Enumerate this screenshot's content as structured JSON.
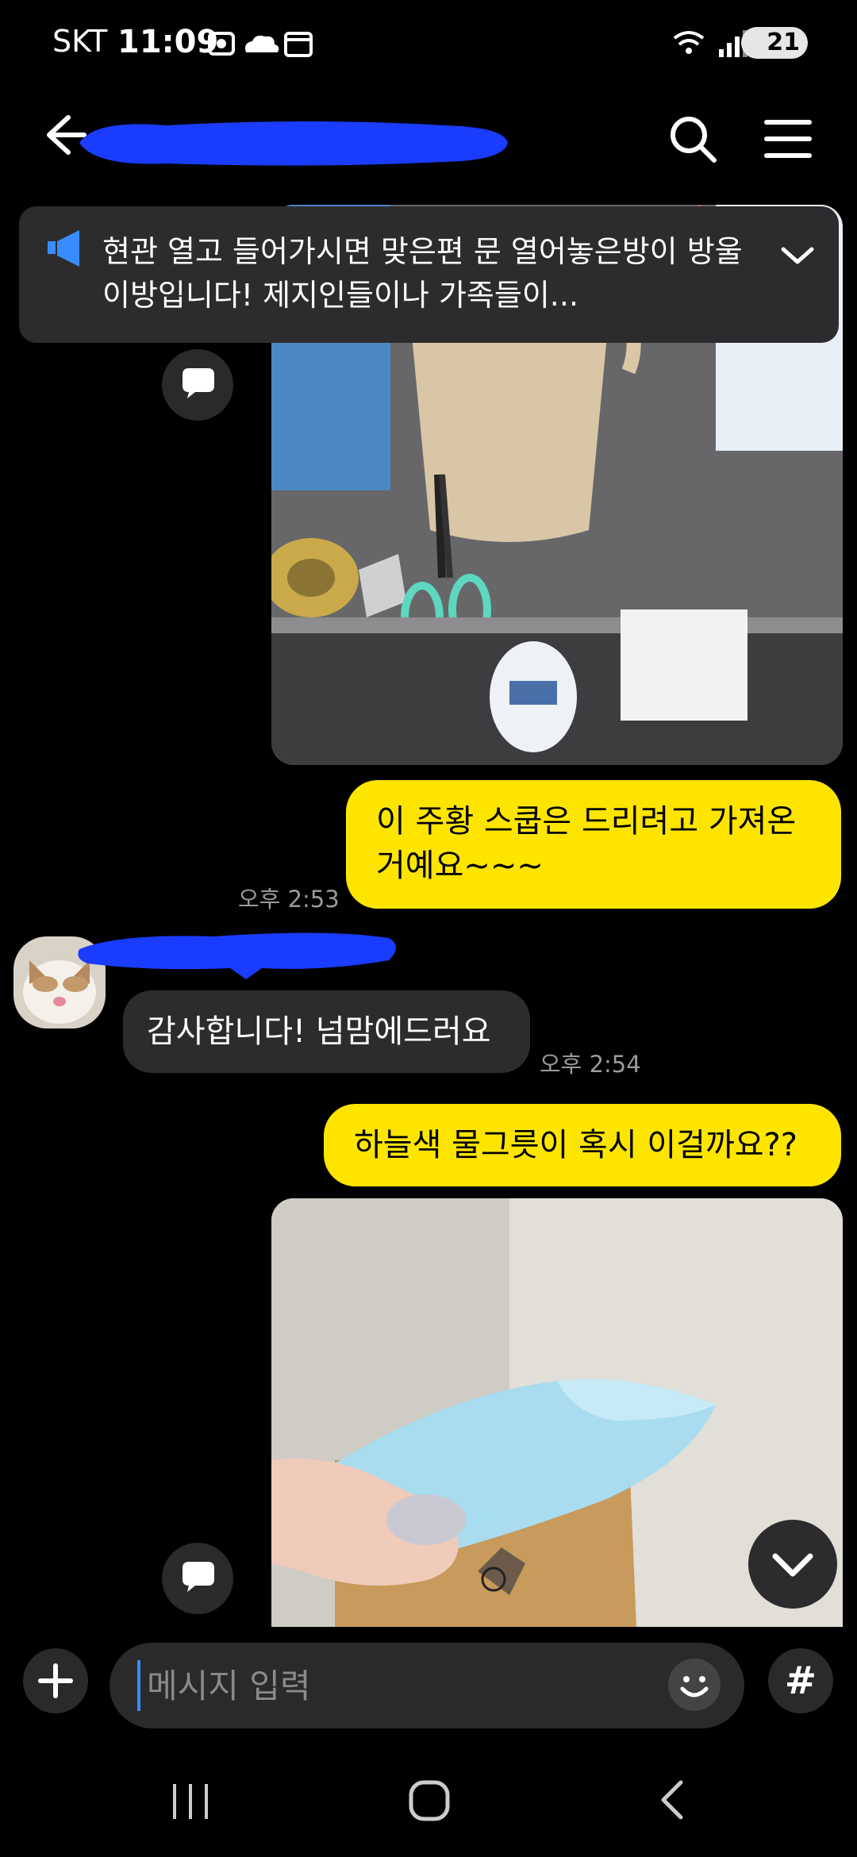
{
  "status_bar": {
    "carrier": "SKT",
    "time": "11:09",
    "battery": "21"
  },
  "header": {
    "title": ""
  },
  "notice": {
    "text": "현관 열고 들어가시면 맞은편 문 열어놓은방이 방울이방입니다! 제지인들이나 가족들이..."
  },
  "messages": [
    {
      "type": "image",
      "from": "me",
      "description_icon": "photo-shelf"
    },
    {
      "type": "text",
      "from": "me",
      "text": "이 주황 스쿱은 드리려고 가져온 거예요~~~",
      "time": "오후 2:53"
    },
    {
      "type": "text",
      "from": "other",
      "text": "감사합니다! 넘맘에드러요",
      "time": "오후 2:54"
    },
    {
      "type": "text",
      "from": "me",
      "text": "하늘색 물그릇이 혹시 이걸까요??"
    },
    {
      "type": "image",
      "from": "me",
      "description_icon": "photo-bowl"
    }
  ],
  "composer": {
    "placeholder": "메시지 입력",
    "hash_label": "#"
  },
  "colors": {
    "my_bubble": "#fee500",
    "other_bubble": "#2c2c2e",
    "background": "#000000",
    "notice_bg": "#2c2c2e",
    "accent": "#3a8bff"
  }
}
